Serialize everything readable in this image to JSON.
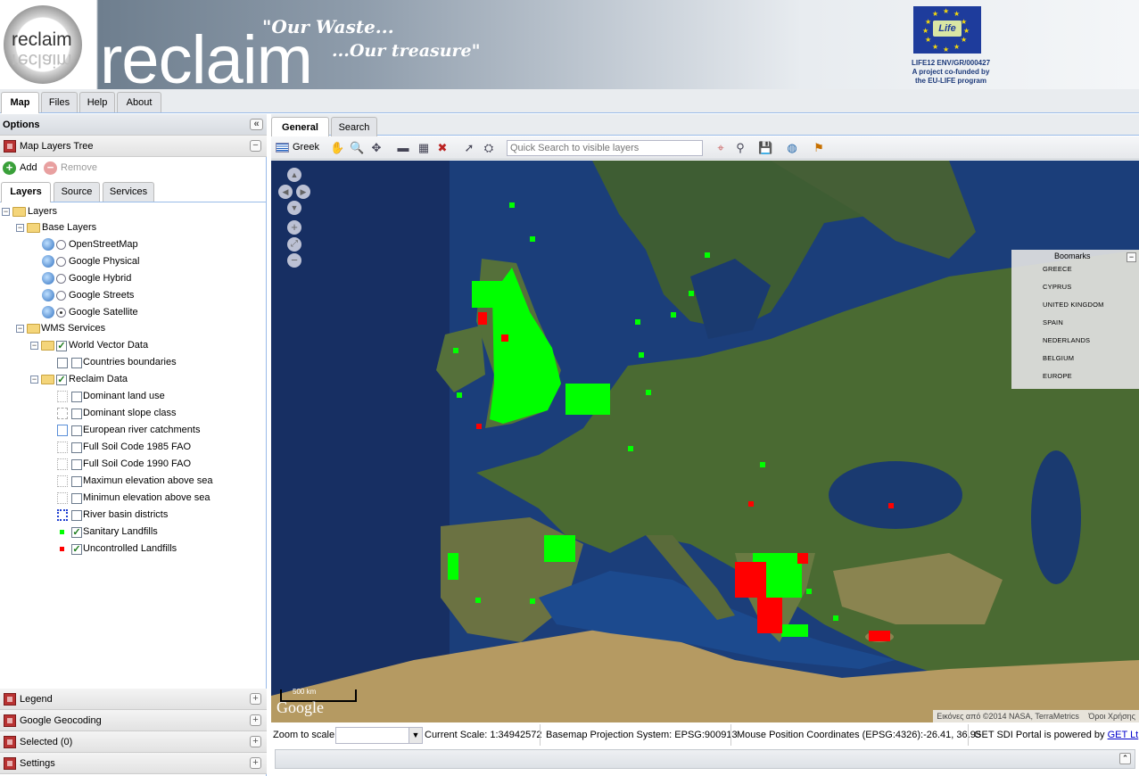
{
  "header": {
    "logo_text": "reclaim",
    "title": "reclaim",
    "slogan_line1": "\"Our Waste...",
    "slogan_line2": "...Our treasure\"",
    "eu_logo_text": "Life",
    "eu_line1": "LIFE12 ENV/GR/000427",
    "eu_line2": "A project co-funded by",
    "eu_line3": "the EU-LIFE program"
  },
  "top_tabs": [
    "Map",
    "Files",
    "Help",
    "About"
  ],
  "left_panel": {
    "options_title": "Options",
    "layers_tree_title": "Map Layers Tree",
    "add_label": "Add",
    "remove_label": "Remove",
    "subtabs": [
      "Layers",
      "Source",
      "Services"
    ],
    "tree": {
      "root": "Layers",
      "base_layers": "Base Layers",
      "base": [
        "OpenStreetMap",
        "Google Physical",
        "Google Hybrid",
        "Google Streets",
        "Google Satellite"
      ],
      "wms_services": "WMS Services",
      "world_vector": "World Vector Data",
      "countries": "Countries boundaries",
      "reclaim_data": "Reclaim Data",
      "reclaim_layers": [
        "Dominant land use",
        "Dominant slope class",
        "European river catchments",
        "Full Soil Code 1985 FAO",
        "Full Soil Code 1990 FAO",
        "Maximun elevation above sea",
        "Minimun elevation above sea",
        "River basin districts",
        "Sanitary Landfills",
        "Uncontrolled Landfills"
      ]
    },
    "bottom_panels": [
      "Legend",
      "Google Geocoding",
      "Selected (0)",
      "Settings"
    ]
  },
  "main_tabs": [
    "General",
    "Search"
  ],
  "toolbar": {
    "language_label": "Greek",
    "quick_search_placeholder": "Quick Search to visible layers"
  },
  "map": {
    "scale_label": "500 km",
    "google_logo": "Google",
    "attribution": "Εικόνες από ©2014 NASA, TerraMetrics",
    "terms": "Όροι Χρήσης",
    "bookmarks_title": "Boomarks",
    "bookmarks": [
      "GREECE",
      "CYPRUS",
      "UNITED KINGDOM",
      "SPAIN",
      "NEDERLANDS",
      "BELGIUM",
      "EUROPE"
    ]
  },
  "statusbar": {
    "zoom_label": "Zoom to scale:",
    "current_scale": "Current Scale: 1:34942572",
    "projection": "Basemap Projection System: EPSG:900913",
    "mouse_coords": "Mouse Position Coordinates (EPSG:4326):-26.41, 36.95",
    "powered_by": "GET SDI Portal is powered by",
    "powered_link": "GET Lt"
  },
  "colors": {
    "sanitary": "#00ff00",
    "uncontrolled": "#ff0000",
    "sea": "#1b3e7a",
    "land": "#4a6a32",
    "accent": "#99bbe8"
  }
}
